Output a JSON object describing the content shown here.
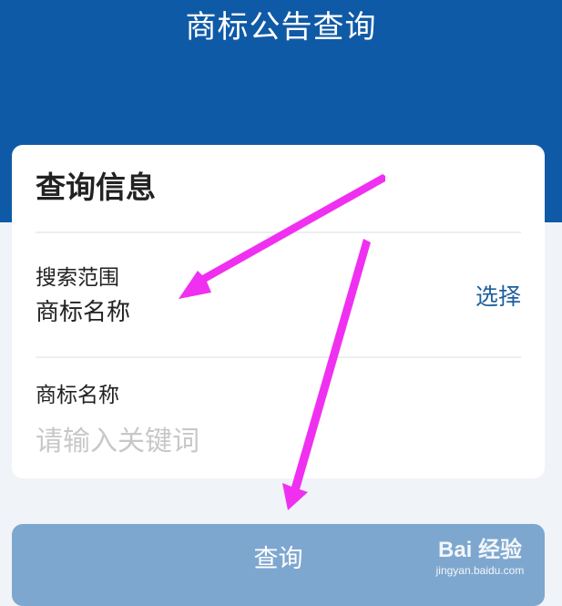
{
  "header": {
    "title": "商标公告查询",
    "background_color": "#0f5aa6"
  },
  "card": {
    "title": "查询信息",
    "search_scope": {
      "label": "搜索范围",
      "value": "商标名称",
      "action_label": "选择"
    },
    "trademark_name": {
      "label": "商标名称",
      "placeholder": "请输入关键词"
    }
  },
  "query_button": {
    "label": "查询",
    "color": "#7ea7cf"
  },
  "annotations": {
    "arrow_color": "#f030f0",
    "arrow_count": 2
  },
  "watermark": {
    "logo_text": "Bai 经验",
    "url": "jingyan.baidu.com"
  }
}
